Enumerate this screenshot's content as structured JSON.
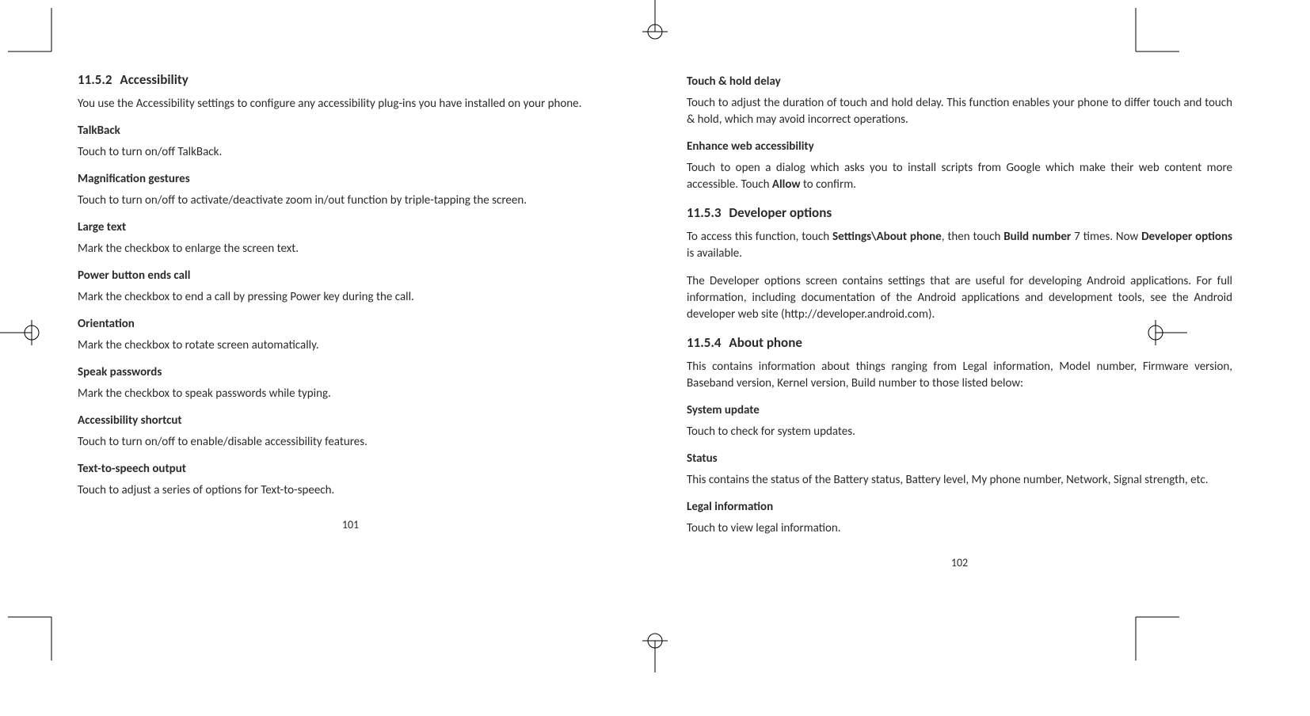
{
  "left": {
    "sec_num": "11.5.2",
    "sec_title": "Accessibility",
    "intro": "You use the Accessibility settings to configure any accessibility plug-ins you have installed on your phone.",
    "items": [
      {
        "h": "TalkBack",
        "p": "Touch to turn on/off TalkBack."
      },
      {
        "h": "Magnification gestures",
        "p": "Touch to turn on/off to activate/deactivate zoom in/out function by triple-tapping the screen."
      },
      {
        "h": "Large text",
        "p": "Mark the checkbox to enlarge the screen text."
      },
      {
        "h": "Power button ends call",
        "p": "Mark the checkbox to end a call by pressing Power key during the call."
      },
      {
        "h": "Orientation",
        "p": "Mark  the checkbox to rotate screen automatically."
      },
      {
        "h": "Speak passwords",
        "p": "Mark  the checkbox to speak passwords while typing."
      },
      {
        "h": "Accessibility shortcut",
        "p": "Touch to turn on/off to enable/disable accessibility features."
      },
      {
        "h": "Text-to-speech output",
        "p": "Touch to adjust a series of options for Text-to-speech."
      }
    ],
    "page_num": "101"
  },
  "right": {
    "top_items": [
      {
        "h": "Touch & hold delay",
        "p": "Touch to adjust the duration of touch and hold delay. This function enables  your phone to differ touch and touch & hold, which may avoid incorrect operations."
      },
      {
        "h": "Enhance web accessibility",
        "p_pre": "Touch to open a dialog which asks you to install scripts from Google which make their web content more accessible. Touch ",
        "p_bold": "Allow",
        "p_post": " to confirm."
      }
    ],
    "sec2_num": "11.5.3",
    "sec2_title": "Developer options",
    "sec2_p1_pre": "To access this function, touch ",
    "sec2_p1_b1": "Settings\\About phone",
    "sec2_p1_mid": ", then touch ",
    "sec2_p1_b2": "Build number",
    "sec2_p1_post1": " 7 times. Now ",
    "sec2_p1_b3": "Developer options",
    "sec2_p1_post2": " is available.",
    "sec2_p2": "The Developer options screen contains settings that are useful for developing Android applications. For full information, including documentation of the Android applications and development tools, see the Android developer web site (http://developer.android.com).",
    "sec3_num": "11.5.4",
    "sec3_title": "About phone",
    "sec3_intro": "This contains information about things ranging from Legal information, Model number, Firmware version, Baseband version, Kernel version, Build number to those listed below:",
    "sec3_items": [
      {
        "h": "System update",
        "p": "Touch to check for system updates."
      },
      {
        "h": "Status",
        "p": "This contains the status of the Battery status, Battery level, My phone number, Network, Signal strength, etc."
      },
      {
        "h": "Legal information",
        "p": "Touch to view legal information."
      }
    ],
    "page_num": "102"
  }
}
